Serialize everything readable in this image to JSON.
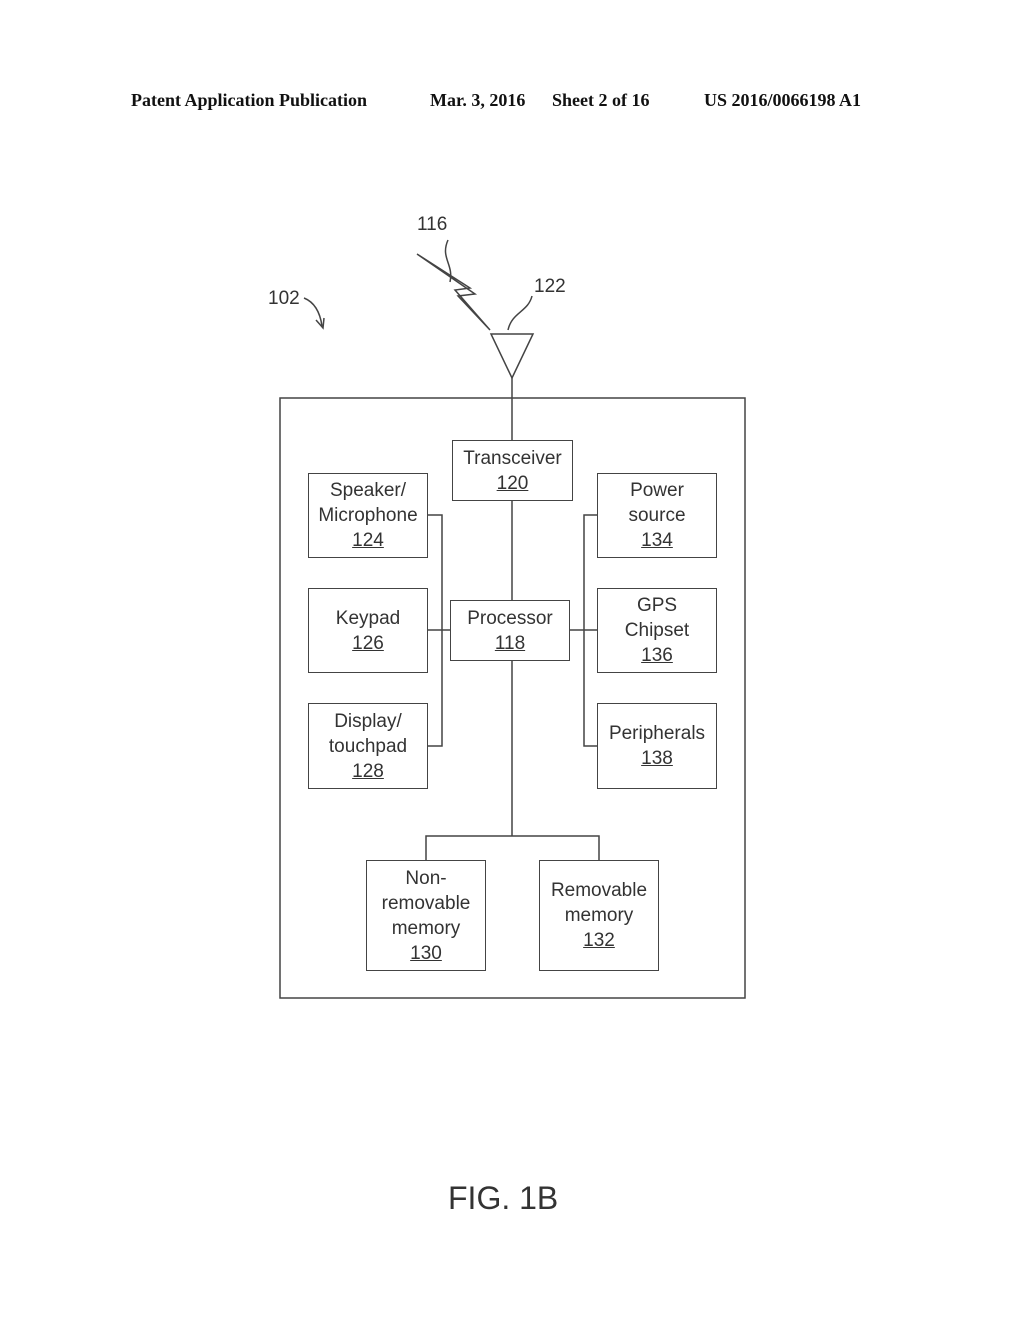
{
  "header": {
    "publication": "Patent Application Publication",
    "date": "Mar. 3, 2016",
    "sheet": "Sheet 2 of 16",
    "number": "US 2016/0066198 A1"
  },
  "refs": {
    "device": "102",
    "signal": "116",
    "antenna": "122"
  },
  "blocks": {
    "transceiver": {
      "label": "Transceiver",
      "num": "120"
    },
    "speaker": {
      "label1": "Speaker/",
      "label2": "Microphone",
      "num": "124"
    },
    "keypad": {
      "label": "Keypad",
      "num": "126"
    },
    "display": {
      "label1": "Display/",
      "label2": "touchpad",
      "num": "128"
    },
    "processor": {
      "label": "Processor",
      "num": "118"
    },
    "power": {
      "label1": "Power",
      "label2": "source",
      "num": "134"
    },
    "gps": {
      "label1": "GPS",
      "label2": "Chipset",
      "num": "136"
    },
    "peripherals": {
      "label": "Peripherals",
      "num": "138"
    },
    "nonremovable": {
      "label1": "Non-",
      "label2": "removable",
      "label3": "memory",
      "num": "130"
    },
    "removable": {
      "label1": "Removable",
      "label2": "memory",
      "num": "132"
    }
  },
  "figure": {
    "caption": "FIG. 1B"
  }
}
